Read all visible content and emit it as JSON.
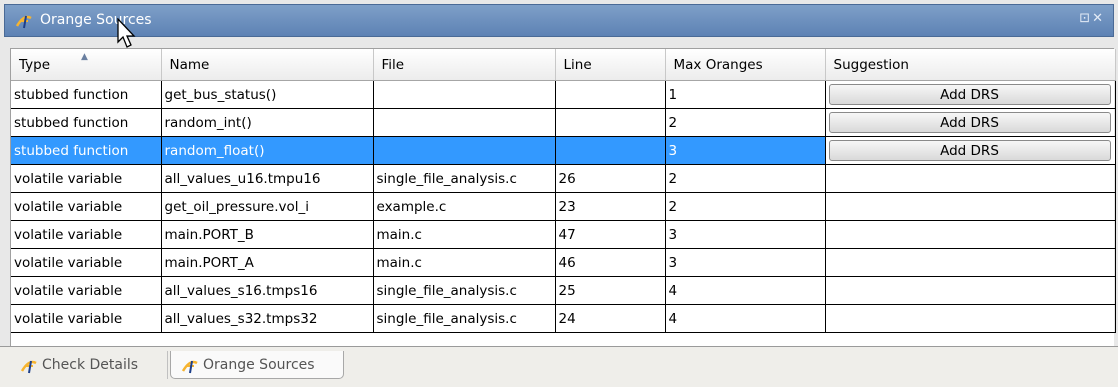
{
  "window": {
    "title": "Orange Sources",
    "controls": "⊡✕"
  },
  "table": {
    "columns": [
      "Type",
      "Name",
      "File",
      "Line",
      "Max Oranges",
      "Suggestion"
    ],
    "rows": [
      {
        "type": "stubbed function",
        "name": "get_bus_status()",
        "file": "",
        "line": "",
        "max_oranges": "1",
        "suggestion": "Add DRS"
      },
      {
        "type": "stubbed function",
        "name": "random_int()",
        "file": "",
        "line": "",
        "max_oranges": "2",
        "suggestion": "Add DRS"
      },
      {
        "type": "stubbed function",
        "name": "random_float()",
        "file": "",
        "line": "",
        "max_oranges": "3",
        "suggestion": "Add DRS"
      },
      {
        "type": "volatile variable",
        "name": "all_values_u16.tmpu16",
        "file": "single_file_analysis.c",
        "line": "26",
        "max_oranges": "2",
        "suggestion": ""
      },
      {
        "type": "volatile variable",
        "name": "get_oil_pressure.vol_i",
        "file": "example.c",
        "line": "23",
        "max_oranges": "2",
        "suggestion": ""
      },
      {
        "type": "volatile variable",
        "name": "main.PORT_B",
        "file": "main.c",
        "line": "47",
        "max_oranges": "3",
        "suggestion": ""
      },
      {
        "type": "volatile variable",
        "name": "main.PORT_A",
        "file": "main.c",
        "line": "46",
        "max_oranges": "3",
        "suggestion": ""
      },
      {
        "type": "volatile variable",
        "name": "all_values_s16.tmps16",
        "file": "single_file_analysis.c",
        "line": "25",
        "max_oranges": "4",
        "suggestion": ""
      },
      {
        "type": "volatile variable",
        "name": "all_values_s32.tmps32",
        "file": "single_file_analysis.c",
        "line": "24",
        "max_oranges": "4",
        "suggestion": ""
      }
    ],
    "selected_row": 2,
    "sorted_column": "Type"
  },
  "tabs": [
    {
      "label": "Check Details",
      "icon": "polyspace-icon"
    },
    {
      "label": "Orange Sources",
      "icon": "polyspace-icon",
      "active": true
    }
  ],
  "colors": {
    "titlebar": "#6a8dbd",
    "selection": "#3399ff"
  }
}
